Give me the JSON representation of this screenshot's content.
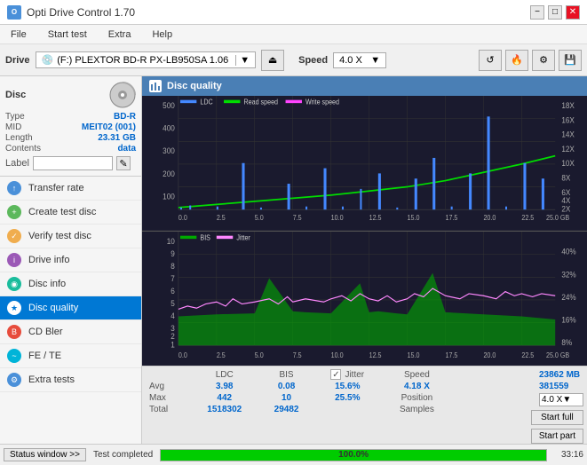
{
  "titlebar": {
    "title": "Opti Drive Control 1.70",
    "min_btn": "−",
    "max_btn": "□",
    "close_btn": "✕"
  },
  "menubar": {
    "items": [
      "File",
      "Start test",
      "Extra",
      "Help"
    ]
  },
  "toolbar": {
    "drive_label": "Drive",
    "drive_value": "(F:)  PLEXTOR BD-R  PX-LB950SA 1.06",
    "speed_label": "Speed",
    "speed_value": "4.0 X"
  },
  "disc": {
    "title": "Disc",
    "type_label": "Type",
    "type_value": "BD-R",
    "mid_label": "MID",
    "mid_value": "MEIT02 (001)",
    "length_label": "Length",
    "length_value": "23.31 GB",
    "contents_label": "Contents",
    "contents_value": "data",
    "label_label": "Label",
    "label_value": ""
  },
  "sidebar": {
    "items": [
      {
        "id": "transfer-rate",
        "label": "Transfer rate",
        "icon": "↑"
      },
      {
        "id": "create-test-disc",
        "label": "Create test disc",
        "icon": "+"
      },
      {
        "id": "verify-test-disc",
        "label": "Verify test disc",
        "icon": "✓"
      },
      {
        "id": "drive-info",
        "label": "Drive info",
        "icon": "i"
      },
      {
        "id": "disc-info",
        "label": "Disc info",
        "icon": "◉"
      },
      {
        "id": "disc-quality",
        "label": "Disc quality",
        "icon": "★",
        "active": true
      },
      {
        "id": "cd-bler",
        "label": "CD Bler",
        "icon": "B"
      },
      {
        "id": "fe-te",
        "label": "FE / TE",
        "icon": "~"
      },
      {
        "id": "extra-tests",
        "label": "Extra tests",
        "icon": "⚙"
      }
    ]
  },
  "chart_header": {
    "title": "Disc quality"
  },
  "chart_top": {
    "legend": {
      "ldc": "LDC",
      "read_speed": "Read speed",
      "write_speed": "Write speed"
    },
    "y_labels_left": [
      "500",
      "400",
      "300",
      "200",
      "100"
    ],
    "y_labels_right": [
      "18X",
      "16X",
      "14X",
      "12X",
      "10X",
      "8X",
      "6X",
      "4X",
      "2X"
    ],
    "x_labels": [
      "0.0",
      "2.5",
      "5.0",
      "7.5",
      "10.0",
      "12.5",
      "15.0",
      "17.5",
      "20.0",
      "22.5",
      "25.0 GB"
    ]
  },
  "chart_bottom": {
    "legend": {
      "bis": "BIS",
      "jitter": "Jitter"
    },
    "y_labels_left": [
      "10",
      "9",
      "8",
      "7",
      "6",
      "5",
      "4",
      "3",
      "2",
      "1"
    ],
    "y_labels_right": [
      "40%",
      "32%",
      "24%",
      "16%",
      "8%"
    ],
    "x_labels": [
      "0.0",
      "2.5",
      "5.0",
      "7.5",
      "10.0",
      "12.5",
      "15.0",
      "17.5",
      "20.0",
      "22.5",
      "25.0 GB"
    ]
  },
  "stats": {
    "col_headers": [
      "LDC",
      "BIS",
      "",
      "Jitter",
      "Speed"
    ],
    "rows": [
      {
        "label": "Avg",
        "ldc": "3.98",
        "bis": "0.08",
        "jitter": "15.6%",
        "speed_label": "4.18 X"
      },
      {
        "label": "Max",
        "ldc": "442",
        "bis": "10",
        "jitter": "25.5%"
      },
      {
        "label": "Total",
        "ldc": "1518302",
        "bis": "29482",
        "jitter": ""
      }
    ],
    "position_label": "Position",
    "position_value": "23862 MB",
    "samples_label": "Samples",
    "samples_value": "381559",
    "speed_display": "4.0 X",
    "jitter_checked": true,
    "start_full_label": "Start full",
    "start_part_label": "Start part"
  },
  "statusbar": {
    "status_window_label": "Status window >>",
    "status_message": "Test completed",
    "progress_value": 100,
    "time_value": "33:16"
  }
}
